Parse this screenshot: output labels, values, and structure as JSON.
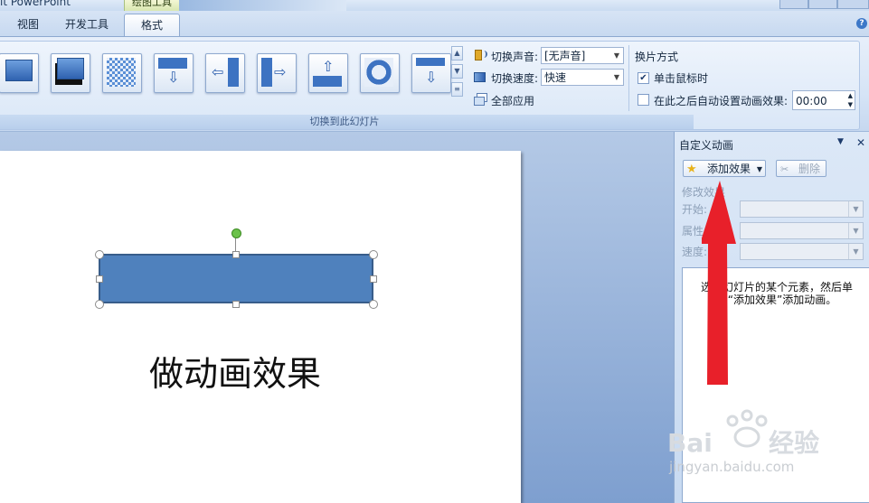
{
  "titlebar": {
    "app_title": "it PowerPoint",
    "context_tab": "绘图工具"
  },
  "tabs": [
    {
      "label": "视图",
      "active": false
    },
    {
      "label": "开发工具",
      "active": false
    },
    {
      "label": "格式",
      "active": false
    }
  ],
  "ribbon": {
    "transition_gallery": [
      {
        "icon": "transition-none-icon"
      },
      {
        "icon": "transition-fade-black-icon"
      },
      {
        "icon": "transition-dissolve-icon"
      },
      {
        "icon": "transition-cover-down-icon"
      },
      {
        "icon": "transition-cover-left-icon"
      },
      {
        "icon": "transition-cover-right-icon"
      },
      {
        "icon": "transition-cover-up-icon"
      },
      {
        "icon": "transition-wheel-icon"
      },
      {
        "icon": "transition-push-down-icon"
      }
    ],
    "sound_label": "切换声音:",
    "sound_value": "[无声音]",
    "speed_label": "切换速度:",
    "speed_value": "快速",
    "apply_all_label": "全部应用",
    "advance_title": "换片方式",
    "on_click_label": "单击鼠标时",
    "on_click_checked": true,
    "auto_after_label": "在此之后自动设置动画效果:",
    "auto_after_checked": false,
    "auto_after_value": "00:00",
    "group_label": "切换到此幻灯片"
  },
  "slide": {
    "text": "做动画效果",
    "shape_color": "#4f81bd"
  },
  "task_pane": {
    "title": "自定义动画",
    "add_effect_label": "添加效果",
    "delete_label": "删除",
    "modify_section": "修改效果",
    "start_label": "开始:",
    "property_label": "属性:",
    "speed_label": "速度:",
    "hint_text": "选中幻灯片的某个元素，然后单击“添加效果”添加动画。"
  },
  "overlay": {
    "arrow_color": "#e8202a",
    "watermark_text": "jingyan.baidu.com"
  }
}
